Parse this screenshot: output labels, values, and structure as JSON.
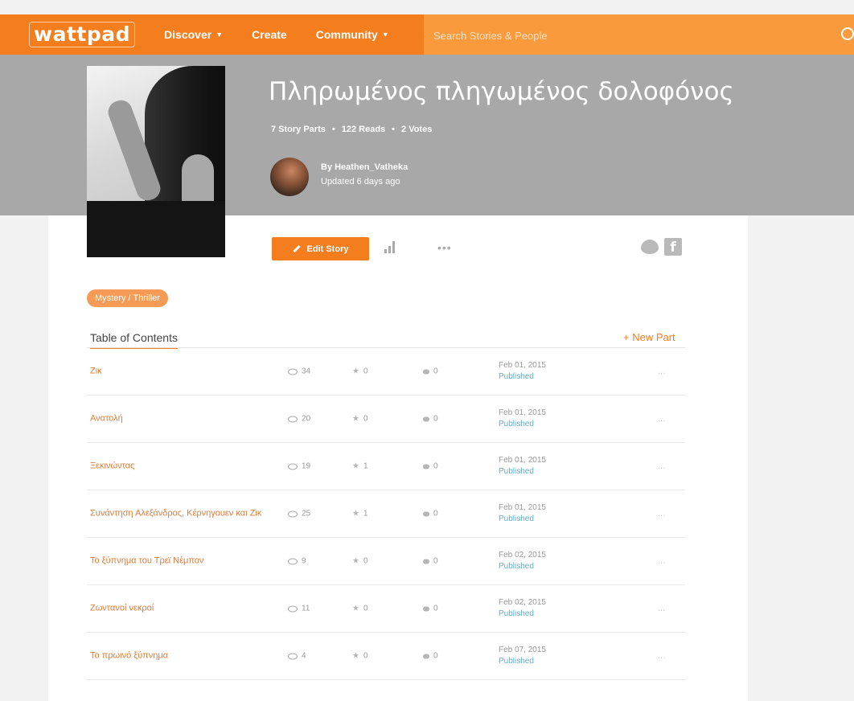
{
  "nav": {
    "logo": "wattpad",
    "discover": "Discover",
    "create": "Create",
    "community": "Community",
    "search_placeholder": "Search Stories & People"
  },
  "story": {
    "title": "Πληρωμένος πληγωμένος δολοφόνος",
    "parts": "7 Story Parts",
    "reads": "122 Reads",
    "votes": "2 Votes",
    "author_by": "By Heathen_Vatheka",
    "updated": "Updated 6 days ago",
    "genre": "Mystery / Thriller"
  },
  "actions": {
    "edit_story": "Edit Story",
    "more": "•••"
  },
  "toc": {
    "title": "Table of Contents",
    "new_part": "+ New Part",
    "rows": [
      {
        "title": "Ζικ",
        "reads": "34",
        "votes": "0",
        "comments": "0",
        "date": "Feb 01, 2015",
        "status": "Published",
        "more": "..."
      },
      {
        "title": "Ανατολή",
        "reads": "20",
        "votes": "0",
        "comments": "0",
        "date": "Feb 01, 2015",
        "status": "Published",
        "more": "..."
      },
      {
        "title": "Ξεκινώντας",
        "reads": "19",
        "votes": "1",
        "comments": "0",
        "date": "Feb 01, 2015",
        "status": "Published",
        "more": "..."
      },
      {
        "title": "Συνάντηση Αλεξάνδρος, Κέρνηγουεν και Ζικ",
        "reads": "25",
        "votes": "1",
        "comments": "0",
        "date": "Feb 01, 2015",
        "status": "Published",
        "more": "..."
      },
      {
        "title": "Το ξύπνημα του Τρεϊ Νέμπον",
        "reads": "9",
        "votes": "0",
        "comments": "0",
        "date": "Feb 02, 2015",
        "status": "Published",
        "more": "..."
      },
      {
        "title": "Ζωντανοί νεκροί",
        "reads": "11",
        "votes": "0",
        "comments": "0",
        "date": "Feb 02, 2015",
        "status": "Published",
        "more": "..."
      },
      {
        "title": "Το πρωινό ξύπνημα",
        "reads": "4",
        "votes": "0",
        "comments": "0",
        "date": "Feb 07, 2015",
        "status": "Published",
        "more": "..."
      }
    ]
  },
  "colors": {
    "brand_orange": "#f47d1e",
    "published_blue": "#5ab1c9",
    "header_gray": "#a8a8a8"
  },
  "icons": [
    "search-icon",
    "pencil-icon",
    "stats-icon",
    "more-icon",
    "twitter-icon",
    "facebook-icon",
    "eye-icon",
    "star-icon",
    "comment-icon"
  ]
}
